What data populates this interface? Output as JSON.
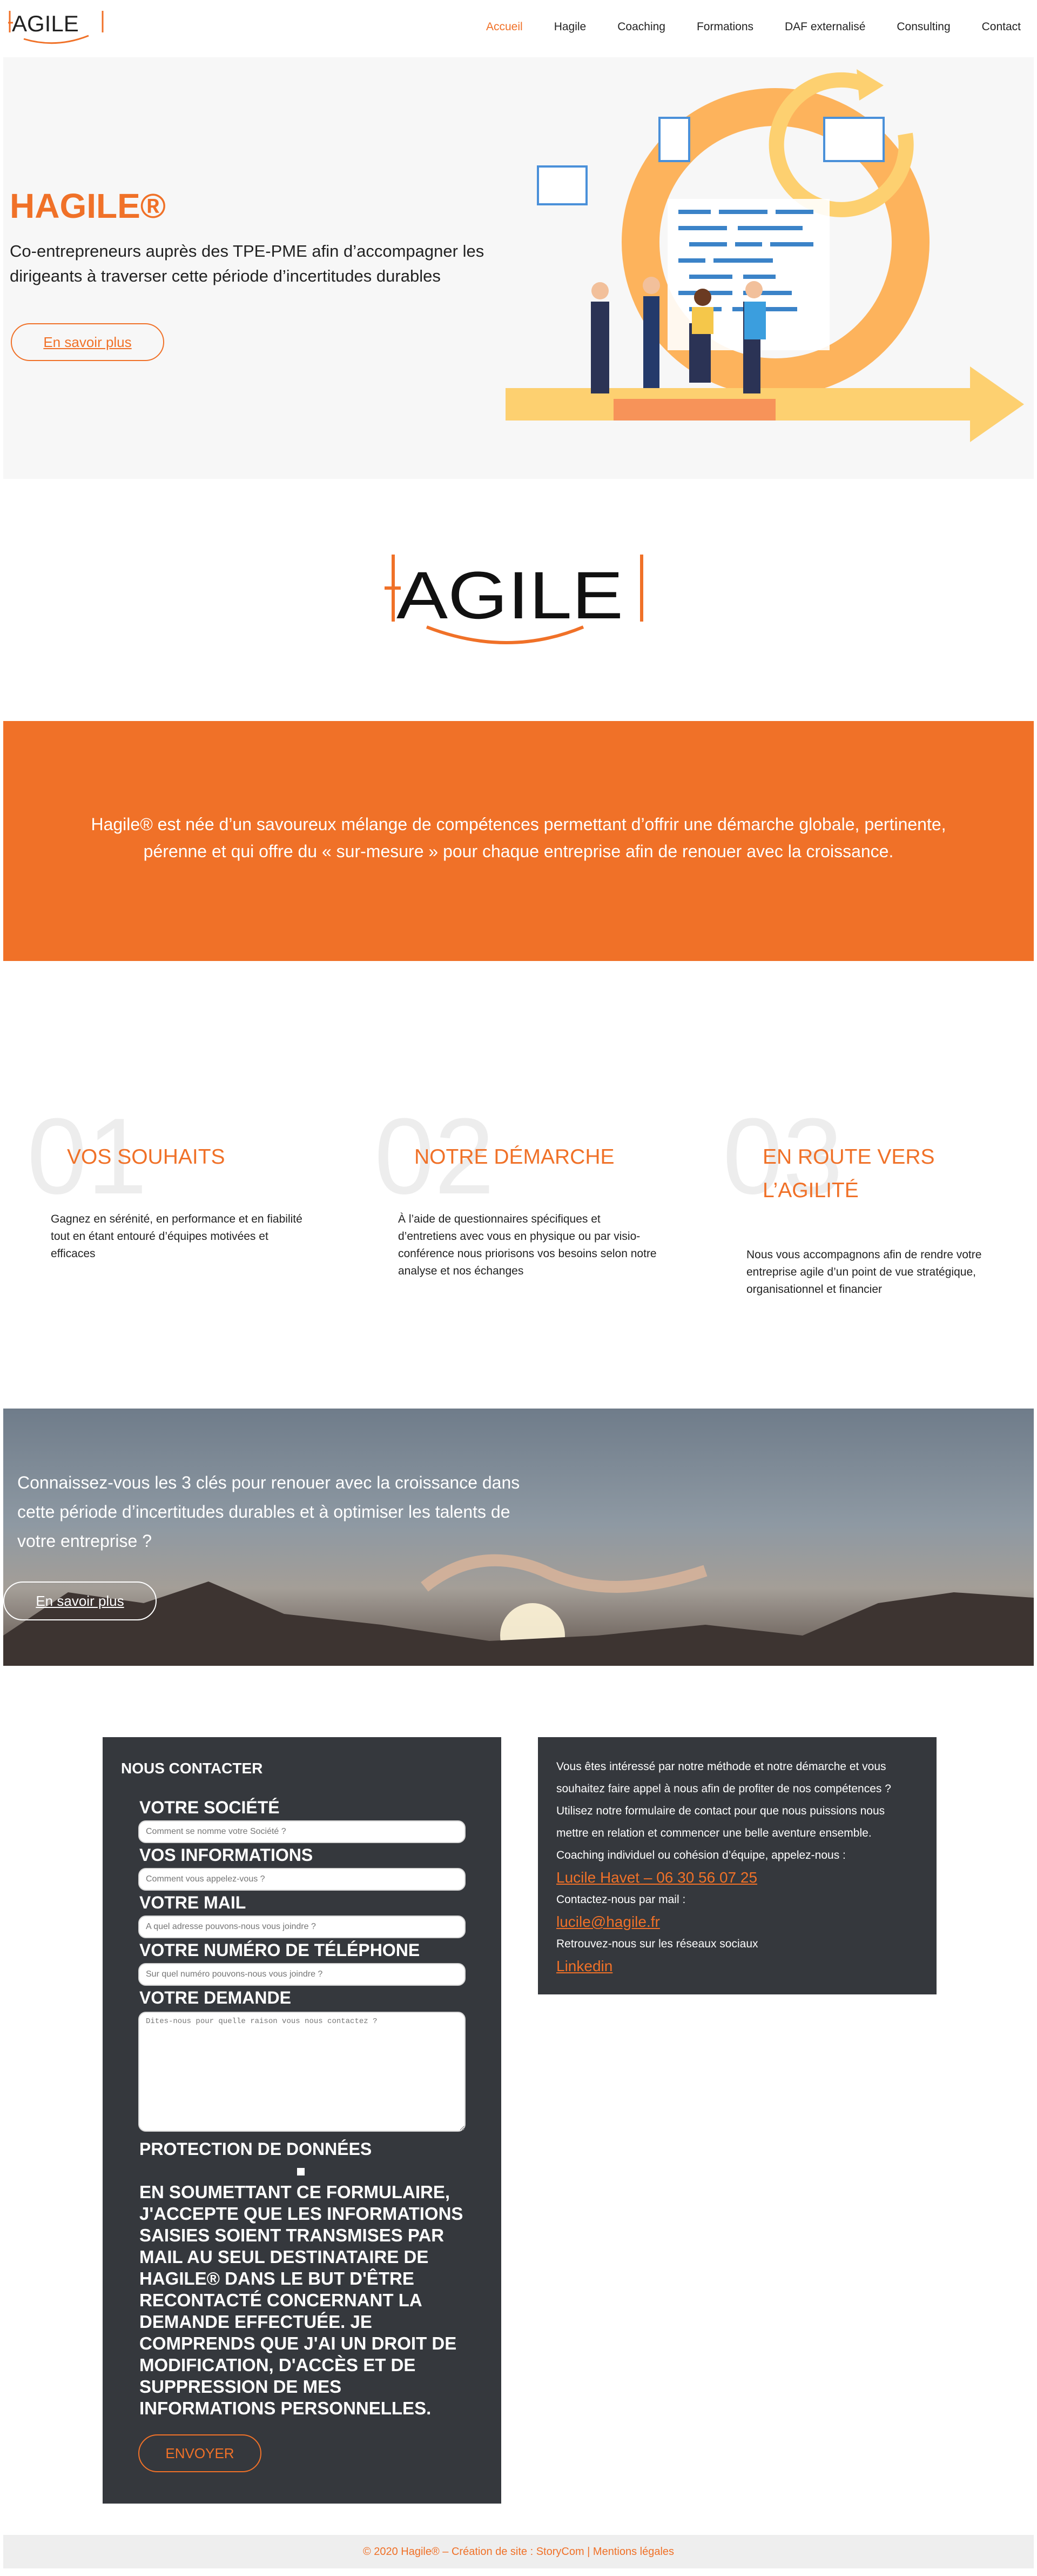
{
  "brand": {
    "name": "HAGILE",
    "accent": "#f07128",
    "dark_card": "#35383d"
  },
  "nav": {
    "items": [
      {
        "label": "Accueil",
        "active": true
      },
      {
        "label": "Hagile",
        "active": false
      },
      {
        "label": "Coaching",
        "active": false
      },
      {
        "label": "Formations",
        "active": false
      },
      {
        "label": "DAF externalisé",
        "active": false
      },
      {
        "label": "Consulting",
        "active": false
      },
      {
        "label": "Contact",
        "active": false
      }
    ]
  },
  "hero": {
    "title": "HAGILE®",
    "subtitle": "Co-entrepreneurs auprès des TPE-PME afin d’accompagner les dirigeants à traverser cette période d’incertitudes durables",
    "button": "En savoir plus"
  },
  "banner": {
    "text": "Hagile® est née d’un savoureux mélange de compétences permettant d’offrir une démarche globale, pertinente, pérenne et qui offre du « sur-mesure » pour chaque entreprise afin de renouer avec la croissance."
  },
  "steps": [
    {
      "num": "01",
      "title": "VOS SOUHAITS",
      "desc": "Gagnez en sérénité, en performance et en fiabilité tout en étant entouré d’équipes motivées et efficaces"
    },
    {
      "num": "02",
      "title": "NOTRE DÉMARCHE",
      "desc": "À l’aide de questionnaires spécifiques et d’entretiens avec vous en physique ou par visio-conférence nous priorisons vos besoins selon notre analyse et nos échanges"
    },
    {
      "num": "03",
      "title": "EN ROUTE VERS L’AGILITÉ",
      "desc": "Nous vous accompagnons afin de rendre votre entreprise agile d’un point de vue stratégique, organisationnel et financier"
    }
  ],
  "photo_section": {
    "text": "Connaissez-vous les 3 clés pour renouer avec la croissance dans cette période d’incertitudes durables et à optimiser les talents de votre entreprise ?",
    "button": "En savoir plus"
  },
  "contact_form": {
    "title": "NOUS CONTACTER",
    "fields": [
      {
        "label": "VOTRE SOCIÉTÉ",
        "placeholder": "Comment se nomme votre Société ?"
      },
      {
        "label": "VOS INFORMATIONS",
        "placeholder": "Comment vous appelez-vous ?"
      },
      {
        "label": "VOTRE MAIL",
        "placeholder": "A quel adresse pouvons-nous vous joindre ?"
      },
      {
        "label": "VOTRE NUMÉRO DE TÉLÉPHONE",
        "placeholder": "Sur quel numéro pouvons-nous vous joindre ?"
      }
    ],
    "message": {
      "label": "VOTRE DEMANDE",
      "placeholder": "Dites-nous pour quelle raison vous nous contactez ?"
    },
    "privacy_label": "PROTECTION DE DONNÉES",
    "consent": "EN SOUMETTANT CE FORMULAIRE, J'ACCEPTE QUE LES INFORMATIONS SAISIES SOIENT TRANSMISES PAR MAIL AU SEUL DESTINATAIRE DE HAGILE® DANS LE BUT D'ÊTRE RECONTACTÉ CONCERNANT LA DEMANDE EFFECTUÉE. JE COMPRENDS QUE J'AI UN DROIT DE MODIFICATION, D'ACCÈS ET DE SUPPRESSION DE MES INFORMATIONS PERSONNELLES.",
    "submit": "ENVOYER"
  },
  "contact_info": {
    "intro": "Vous êtes intéressé par notre méthode et notre démarche et vous souhaitez faire appel à nous afin de profiter de nos compétences ? Utilisez notre formulaire de contact pour que nous puissions nous mettre en relation et commencer une belle aventure ensemble.",
    "coaching": "Coaching individuel ou cohésion d’équipe, appelez-nous :",
    "phone": "Lucile Havet – 06 30 56 07 25",
    "mail_label": "Contactez-nous par mail :",
    "mail": "lucile@hagile.fr",
    "social_label": "Retrouvez-nous sur les réseaux sociaux",
    "social": "Linkedin"
  },
  "footer": {
    "text": "© 2020 Hagile® – Création de site : StoryCom | Mentions légales"
  }
}
